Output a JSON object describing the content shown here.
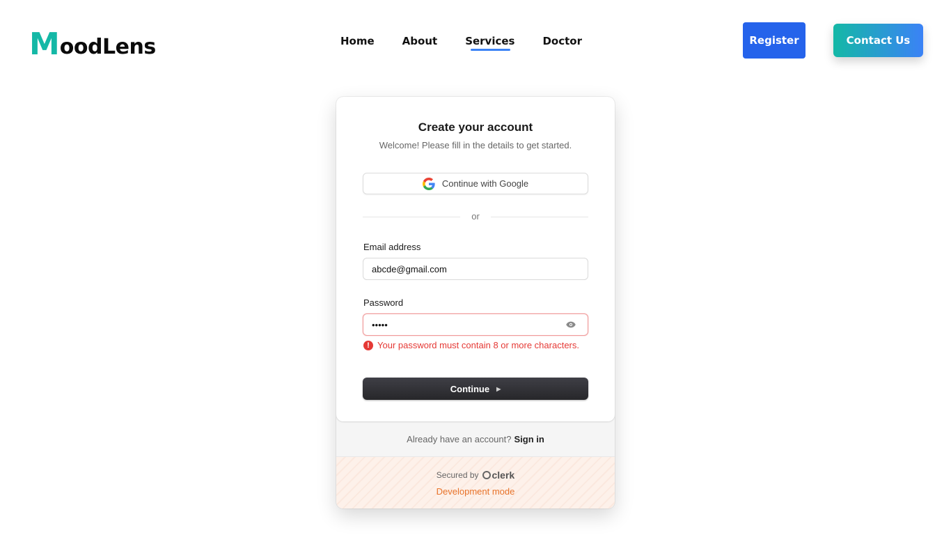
{
  "brand": {
    "logo_first": "M",
    "logo_rest": "oodLens",
    "accent": "#14b8a6"
  },
  "nav": {
    "items": [
      {
        "label": "Home",
        "active": false
      },
      {
        "label": "About",
        "active": false
      },
      {
        "label": "Services",
        "active": true
      },
      {
        "label": "Doctor",
        "active": false
      }
    ],
    "active_underline_color": "#3b82f6"
  },
  "header": {
    "register_label": "Register",
    "contact_label": "Contact Us"
  },
  "signup": {
    "title": "Create your account",
    "subtitle": "Welcome! Please fill in the details to get started.",
    "google_label": "Continue with Google",
    "divider_text": "or",
    "email_label": "Email address",
    "email_value": "abcde@gmail.com",
    "password_label": "Password",
    "password_value": "•••••",
    "password_error": "Your password must contain 8 or more characters.",
    "continue_label": "Continue",
    "signin_prompt": "Already have an account?",
    "signin_link": "Sign in",
    "secured_by": "Secured by",
    "clerk_brand": "clerk",
    "dev_mode": "Development mode"
  },
  "colors": {
    "error": "#e53935",
    "dev_mode": "#e8732a",
    "register_bg": "#2563eb"
  }
}
